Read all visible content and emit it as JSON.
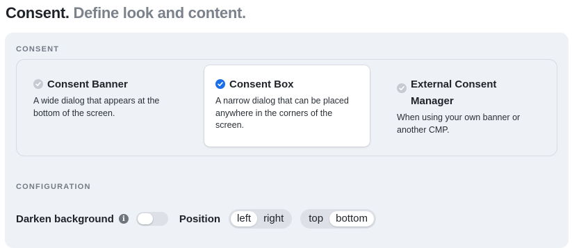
{
  "header": {
    "title": "Consent.",
    "subtitle": "Define look and content."
  },
  "consent_section": {
    "label": "CONSENT",
    "selected": "Consent Box",
    "options": [
      {
        "title": "Consent Banner",
        "description": "A wide dialog that appears at the bottom of the screen.",
        "icon": "check-circle-icon",
        "active": false
      },
      {
        "title": "Consent Box",
        "description": "A narrow dialog that can be placed anywhere in the corners of the screen.",
        "icon": "check-circle-icon",
        "active": true
      },
      {
        "title": "External Consent Manager",
        "description": "When using your own banner or another CMP.",
        "icon": "check-circle-icon",
        "active": false
      }
    ]
  },
  "configuration": {
    "label": "CONFIGURATION",
    "darken_background": {
      "label": "Darken background",
      "info_icon": "info-icon",
      "enabled": false
    },
    "position": {
      "label": "Position",
      "horizontal": {
        "options": [
          "left",
          "right"
        ],
        "selected": "left"
      },
      "vertical": {
        "options": [
          "top",
          "bottom"
        ],
        "selected": "bottom"
      }
    }
  },
  "colors": {
    "accent": "#1a6fe8",
    "panel_bg": "#eef1f6",
    "subtitle": "#7c828b"
  }
}
